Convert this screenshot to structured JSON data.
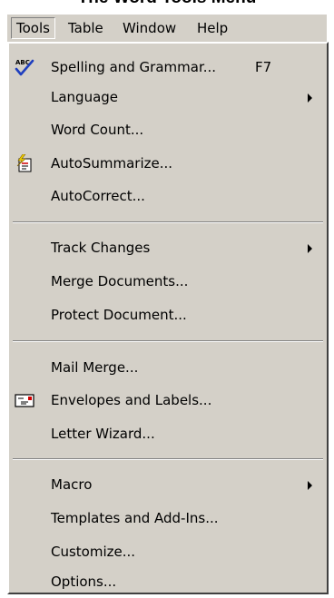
{
  "caption": "The Word Tools Menu",
  "menubar": [
    "Tools",
    "Table",
    "Window",
    "Help"
  ],
  "menu": {
    "items": [
      {
        "label": "Spelling and Grammar...",
        "shortcut": "F7",
        "icon": "spelling-check-icon"
      },
      {
        "label": "Language",
        "submenu": true
      },
      {
        "label": "Word Count..."
      },
      {
        "label": "AutoSummarize...",
        "icon": "autosummarize-icon"
      },
      {
        "label": "AutoCorrect..."
      },
      {
        "label": "Track Changes",
        "submenu": true
      },
      {
        "label": "Merge Documents..."
      },
      {
        "label": "Protect Document..."
      },
      {
        "label": "Mail Merge..."
      },
      {
        "label": "Envelopes and Labels...",
        "icon": "envelope-icon"
      },
      {
        "label": "Letter Wizard..."
      },
      {
        "label": "Macro",
        "submenu": true
      },
      {
        "label": "Templates and Add-Ins..."
      },
      {
        "label": "Customize..."
      },
      {
        "label": "Options..."
      }
    ]
  },
  "colors": {
    "menu_face": "#d4d0c8",
    "shadow": "#808080",
    "dark_shadow": "#404040",
    "highlight": "#ffffff",
    "check_blue": "#1f3fbf"
  }
}
